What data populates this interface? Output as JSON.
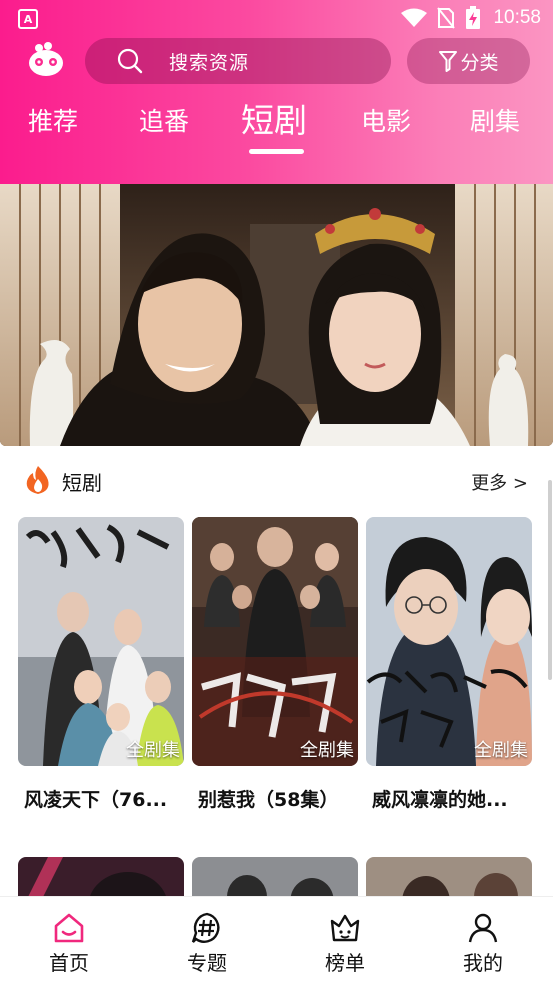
{
  "status_bar": {
    "app_badge": "A",
    "time": "10:58"
  },
  "header": {
    "search_placeholder": "搜索资源",
    "category_label": "分类",
    "tabs": [
      {
        "label": "推荐",
        "active": false
      },
      {
        "label": "追番",
        "active": false
      },
      {
        "label": "短剧",
        "active": true
      },
      {
        "label": "电影",
        "active": false
      },
      {
        "label": "剧集",
        "active": false
      }
    ]
  },
  "section": {
    "title": "短剧",
    "more_label": "更多 >",
    "cards": [
      {
        "title": "风凌天下（76...",
        "badge": "全剧集",
        "poster_text": "风凌天下"
      },
      {
        "title": "别惹我（58集）",
        "badge": "全剧集",
        "poster_text": "别惹我"
      },
      {
        "title": "威风凛凛的她...",
        "badge": "全剧集",
        "poster_text": "你的深情我不配"
      }
    ]
  },
  "bottom_nav": {
    "items": [
      {
        "label": "首页",
        "icon": "home-icon",
        "active": true
      },
      {
        "label": "专题",
        "icon": "hashtag-icon",
        "active": false
      },
      {
        "label": "榜单",
        "icon": "crown-icon",
        "active": false
      },
      {
        "label": "我的",
        "icon": "user-icon",
        "active": false
      }
    ]
  },
  "colors": {
    "accent": "#fb1c8d",
    "active_nav": "#f0287d",
    "fire": "#f26522"
  }
}
